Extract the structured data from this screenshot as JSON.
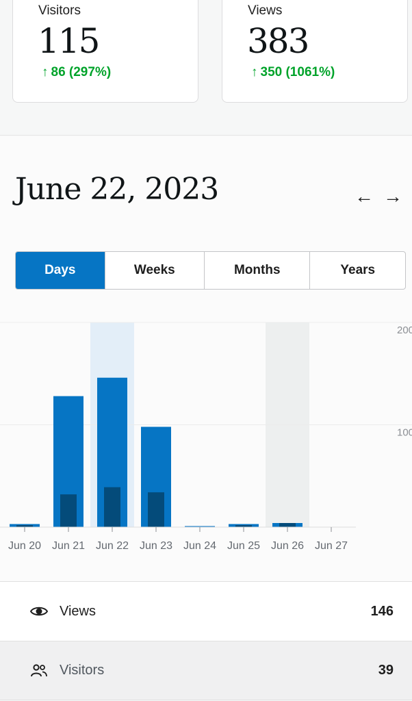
{
  "stats": {
    "visitors": {
      "label": "Visitors",
      "value": "115",
      "delta_arrow": "↑",
      "delta": "86 (297%)"
    },
    "views": {
      "label": "Views",
      "value": "383",
      "delta_arrow": "↑",
      "delta": "350 (1061%)"
    }
  },
  "date_header": {
    "title": "June 22, 2023",
    "prev_icon": "arrow-left-icon",
    "next_icon": "arrow-right-icon",
    "prev_glyph": "←",
    "next_glyph": "→"
  },
  "tabs": [
    {
      "label": "Days",
      "active": true
    },
    {
      "label": "Weeks",
      "active": false
    },
    {
      "label": "Months",
      "active": false
    },
    {
      "label": "Years",
      "active": false
    }
  ],
  "chart_data": {
    "type": "bar",
    "categories": [
      "Jun 20",
      "Jun 21",
      "Jun 22",
      "Jun 23",
      "Jun 24",
      "Jun 25",
      "Jun 26",
      "Jun 27"
    ],
    "series": [
      {
        "values": [
          3,
          128,
          146,
          98,
          1,
          3,
          4,
          0
        ],
        "color": "#0675c4"
      },
      {
        "values": [
          2,
          32,
          39,
          34,
          0,
          2,
          4,
          0
        ],
        "color": "#044b7a"
      }
    ],
    "y_ticks": [
      "200",
      "100"
    ],
    "ylim": [
      0,
      200
    ],
    "selected_category": "Jun 22",
    "highlighted_category": "Jun 26",
    "grid": true
  },
  "summary": {
    "views": {
      "icon": "eye-icon",
      "label": "Views",
      "value": "146"
    },
    "visitors": {
      "icon": "people-icon",
      "label": "Visitors",
      "value": "39"
    }
  },
  "colors": {
    "accent": "#0675c4",
    "accent_dark": "#044b7a",
    "positive": "#00a32a",
    "selected_band": "#e3eef8",
    "highlight_band": "#edefef"
  }
}
